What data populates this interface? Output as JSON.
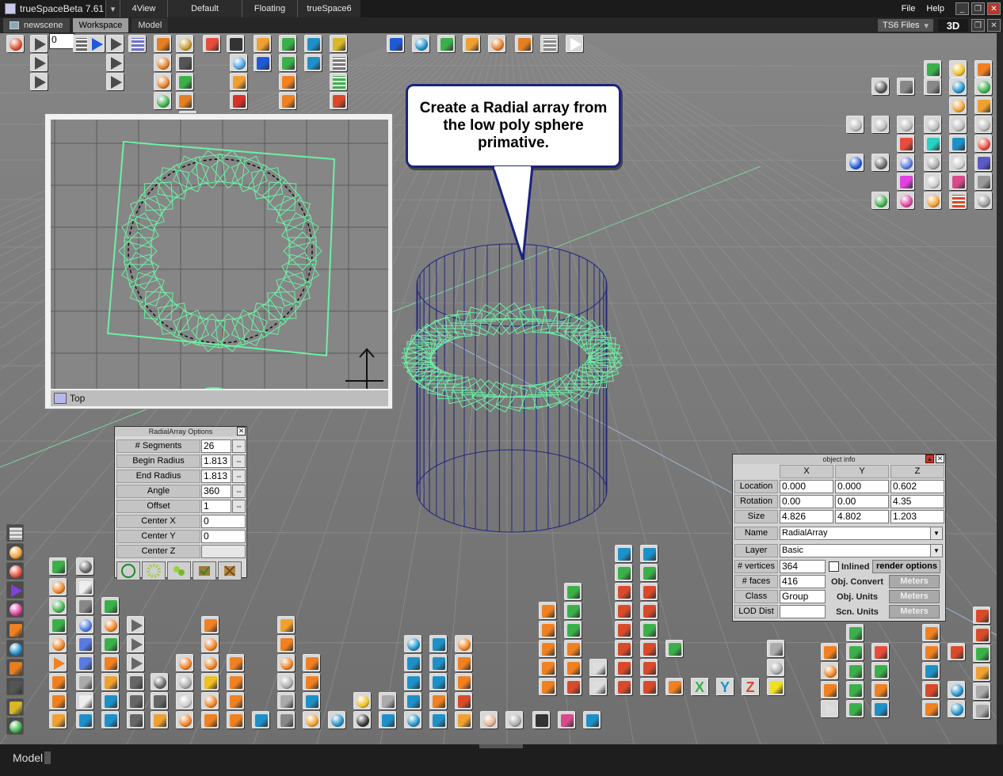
{
  "window": {
    "title": "trueSpaceBeta 7.61",
    "title_tabs": [
      "4View",
      "Default",
      "Floating",
      "trueSpace6"
    ],
    "menu": [
      "File",
      "Help"
    ]
  },
  "tabs": [
    {
      "label": "newscene",
      "active": false
    },
    {
      "label": "Workspace",
      "active": true
    },
    {
      "label": "Model",
      "active": false
    }
  ],
  "ts6files": "TS6 Files",
  "mode_3d": "3D",
  "anim": {
    "frame": "0"
  },
  "callout": "Create a Radial array from the low poly sphere primative.",
  "top_view": {
    "label": "Top"
  },
  "radial_options": {
    "title": "RadialArray Options",
    "rows": [
      {
        "label": "# Segments",
        "value": "26"
      },
      {
        "label": "Begin Radius",
        "value": "1.813"
      },
      {
        "label": "End Radius",
        "value": "1.813"
      },
      {
        "label": "Angle",
        "value": "360"
      },
      {
        "label": "Offset",
        "value": "1"
      },
      {
        "label": "Center X",
        "value": "0"
      },
      {
        "label": "Center Y",
        "value": "0"
      },
      {
        "label": "Center Z",
        "value": ""
      }
    ]
  },
  "object_info": {
    "title": "object info",
    "columns": [
      "X",
      "Y",
      "Z"
    ],
    "location": {
      "label": "Location",
      "x": "0.000",
      "y": "0.000",
      "z": "0.602"
    },
    "rotation": {
      "label": "Rotation",
      "x": "0.00",
      "y": "0.00",
      "z": "4.35"
    },
    "size": {
      "label": "Size",
      "x": "4.826",
      "y": "4.802",
      "z": "1.203"
    },
    "name_label": "Name",
    "name": "RadialArray",
    "layer_label": "Layer",
    "layer": "Basic",
    "vertices_label": "# vertices",
    "vertices": "364",
    "faces_label": "# faces",
    "faces": "416",
    "class_label": "Class",
    "class": "Group",
    "lod_label": "LOD Dist",
    "lod": "",
    "inlined_label": "Inlined",
    "render_options": "render options",
    "obj_convert": "Obj. Convert",
    "obj_units": "Obj. Units",
    "scn_units": "Scn. Units",
    "unit_values": [
      "Meters",
      "Meters",
      "Meters"
    ]
  },
  "status": {
    "mode": "Model"
  },
  "bottom_labels": {
    "x": "X",
    "y": "Y",
    "z": "Z"
  },
  "colors": {
    "accent_green": "#6cf0a4",
    "wire_blue": "#2a2f8a",
    "callout_border": "#1a237e"
  }
}
